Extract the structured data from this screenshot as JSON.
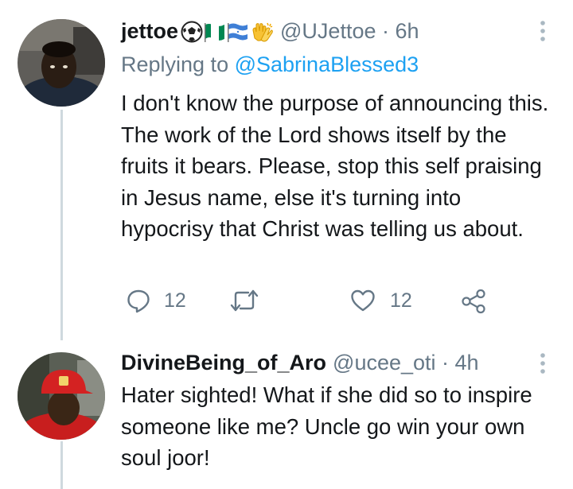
{
  "tweets": [
    {
      "display_name": "jettoe",
      "handle_time": "@UJettoe · 6h",
      "replying_prefix": "Replying to",
      "replying_to": "@SabrinaBlessed3",
      "text": "I don't know the purpose of announcing this. The work of the Lord shows itself by the fruits it bears. Please, stop this self praising in Jesus name, else it's turning into hypocrisy that Christ was telling us about.",
      "reply_count": "12",
      "like_count": "12",
      "emojis": [
        "soccer-ball",
        "flag-nigeria",
        "flag-honduras",
        "clapping-hands"
      ]
    },
    {
      "display_name": "DivineBeing_of_Aro",
      "handle_time": "@ucee_oti · 4h",
      "text": "Hater sighted! What if she did so to inspire someone like me? Uncle go win your own soul joor!"
    }
  ],
  "colors": {
    "text": "#14171a",
    "secondary": "#657786",
    "link": "#1da1f2",
    "thread_line": "#cfd9de"
  }
}
